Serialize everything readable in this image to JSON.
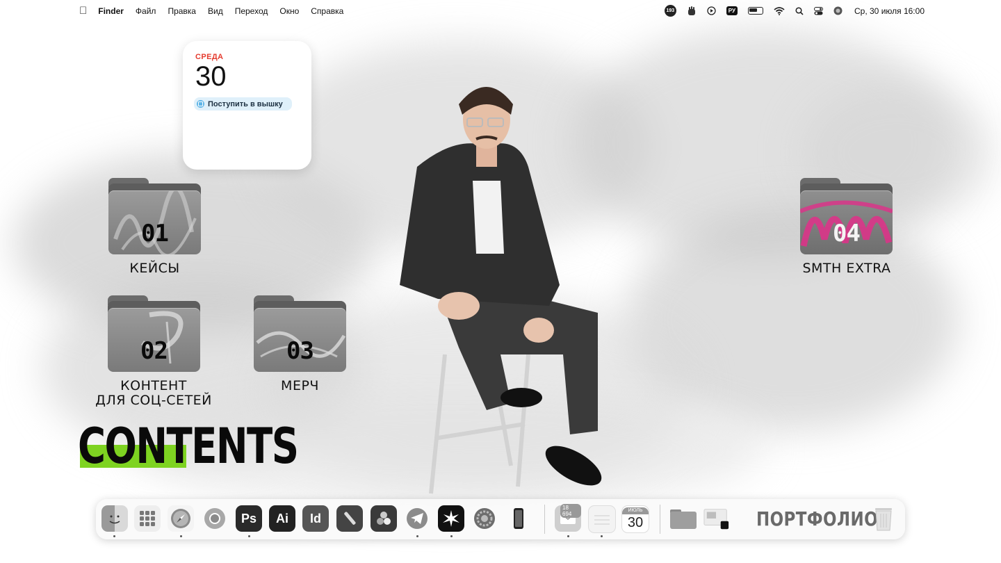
{
  "menubar": {
    "apple": "",
    "app_name": "Finder",
    "menus": [
      "Файл",
      "Правка",
      "Вид",
      "Переход",
      "Окно",
      "Справка"
    ],
    "status": {
      "badge_count": "193",
      "keyboard": "РУ",
      "datetime": "Ср, 30 июля  16:00"
    }
  },
  "calendar_widget": {
    "weekday": "СРЕДА",
    "day": "30",
    "event": "Поступить в вышку"
  },
  "folders": [
    {
      "number": "01",
      "label": "КЕЙСЫ"
    },
    {
      "number": "02",
      "label_line1": "КОНТЕНТ",
      "label_line2": "ДЛЯ СОЦ-СЕТЕЙ"
    },
    {
      "number": "03",
      "label": "МЕРЧ"
    },
    {
      "number": "04",
      "label": "SMTH EXTRA"
    }
  ],
  "title": "CONTENTS",
  "accent_color": "#7ed321",
  "dock": {
    "apps": [
      {
        "name": "finder-icon"
      },
      {
        "name": "launchpad-icon"
      },
      {
        "name": "safari-icon"
      },
      {
        "name": "chrome-icon"
      },
      {
        "name": "photoshop-icon",
        "text": "Ps"
      },
      {
        "name": "illustrator-icon",
        "text": "Ai"
      },
      {
        "name": "indesign-icon",
        "text": "Id"
      },
      {
        "name": "pen-app-icon"
      },
      {
        "name": "davinci-icon"
      },
      {
        "name": "telegram-icon"
      },
      {
        "name": "capcut-icon"
      },
      {
        "name": "settings-icon"
      },
      {
        "name": "iphone-mirroring-icon"
      }
    ],
    "mail_badge": "18 694",
    "calendar_month": "ИЮЛЬ",
    "calendar_day": "30",
    "portfolio": "ПОРТФОЛИО"
  }
}
